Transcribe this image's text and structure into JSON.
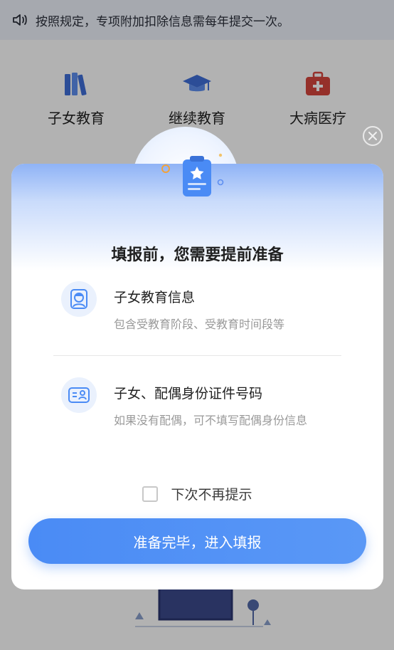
{
  "notice": {
    "text": "按照规定，专项附加扣除信息需每年提交一次。",
    "icon": "speaker-icon"
  },
  "categories": [
    {
      "label": "子女教育",
      "icon": "books-icon"
    },
    {
      "label": "继续教育",
      "icon": "graduation-cap-icon"
    },
    {
      "label": "大病医疗",
      "icon": "medical-kit-icon"
    }
  ],
  "modal": {
    "title": "填报前，您需要提前准备",
    "close_icon": "close-icon",
    "items": [
      {
        "title": "子女教育信息",
        "desc": "包含受教育阶段、受教育时间段等",
        "icon": "child-portrait-icon"
      },
      {
        "title": "子女、配偶身份证件号码",
        "desc": "如果没有配偶，可不填写配偶身份信息",
        "icon": "id-card-icon"
      }
    ],
    "no_remind_label": "下次不再提示",
    "no_remind_checked": false,
    "confirm_label": "准备完毕，进入填报"
  },
  "colors": {
    "accent": "#4a8bf5",
    "notice_bg": "#eef2fb",
    "medical_red": "#d6453d"
  }
}
